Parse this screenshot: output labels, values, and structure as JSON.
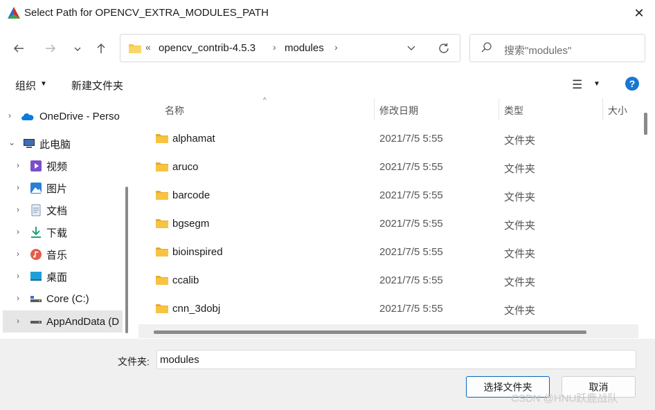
{
  "window": {
    "title": "Select Path for OPENCV_EXTRA_MODULES_PATH",
    "close_glyph": "✕"
  },
  "address": {
    "overflow": "«",
    "segments": [
      "opencv_contrib-4.5.3",
      "modules"
    ],
    "separator": "›"
  },
  "search": {
    "placeholder": "搜索\"modules\""
  },
  "toolbar": {
    "organize": "组织",
    "new_folder": "新建文件夹"
  },
  "nav": {
    "items": [
      {
        "label": "OneDrive - Perso",
        "icon": "onedrive-icon"
      },
      {
        "label": "此电脑",
        "icon": "computer-icon"
      },
      {
        "label": "视频",
        "icon": "videos-icon"
      },
      {
        "label": "图片",
        "icon": "pictures-icon"
      },
      {
        "label": "文档",
        "icon": "documents-icon"
      },
      {
        "label": "下载",
        "icon": "downloads-icon"
      },
      {
        "label": "音乐",
        "icon": "music-icon"
      },
      {
        "label": "桌面",
        "icon": "desktop-icon"
      },
      {
        "label": "Core (C:)",
        "icon": "drive-icon"
      },
      {
        "label": "AppAndData (D",
        "icon": "drive-icon"
      }
    ]
  },
  "columns": {
    "name": "名称",
    "date": "修改日期",
    "type": "类型",
    "size": "大小"
  },
  "files": [
    {
      "name": "alphamat",
      "date": "2021/7/5 5:55",
      "type": "文件夹"
    },
    {
      "name": "aruco",
      "date": "2021/7/5 5:55",
      "type": "文件夹"
    },
    {
      "name": "barcode",
      "date": "2021/7/5 5:55",
      "type": "文件夹"
    },
    {
      "name": "bgsegm",
      "date": "2021/7/5 5:55",
      "type": "文件夹"
    },
    {
      "name": "bioinspired",
      "date": "2021/7/5 5:55",
      "type": "文件夹"
    },
    {
      "name": "ccalib",
      "date": "2021/7/5 5:55",
      "type": "文件夹"
    },
    {
      "name": "cnn_3dobj",
      "date": "2021/7/5 5:55",
      "type": "文件夹"
    }
  ],
  "footer": {
    "folder_label": "文件夹:",
    "folder_value": "modules",
    "select_button": "选择文件夹",
    "cancel_button": "取消",
    "watermark": "CSDN @HNU跃鹿战队"
  },
  "colors": {
    "accent": "#0067c0",
    "folder": "#f6c343",
    "help": "#1976d2"
  }
}
